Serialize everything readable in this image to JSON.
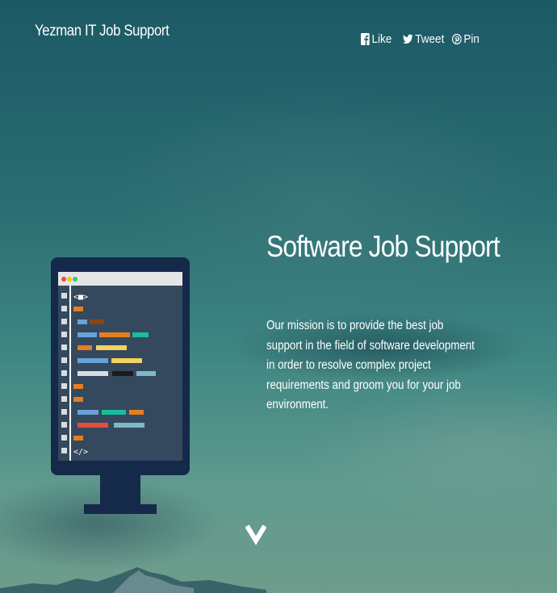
{
  "header": {
    "brand": "Yezman IT Job Support"
  },
  "share": {
    "like_label": "Like",
    "tweet_label": "Tweet",
    "pin_label": "Pin",
    "icons": [
      "facebook-icon",
      "twitter-icon",
      "pinterest-icon"
    ]
  },
  "hero": {
    "title": "Software Job Support",
    "description": "Our mission is to provide the best job support in the field of software development in order to resolve complex project requirements and groom you for your job environment.",
    "illustration": "code-monitor-illustration",
    "code_open_tag": "<■>",
    "code_close_tag": "</>"
  },
  "scroll": {
    "icon": "chevron-down-icon"
  },
  "colors": {
    "monitor_frame": "#15294a",
    "screen": "#34495e",
    "title_bar": "#e5e5e5",
    "code_orange": "#e67e22",
    "code_blue": "#6aa2d8",
    "code_teal": "#1abc9c",
    "code_yellow": "#f4d35e",
    "code_red": "#e74c3c",
    "code_brown": "#8b4513"
  }
}
